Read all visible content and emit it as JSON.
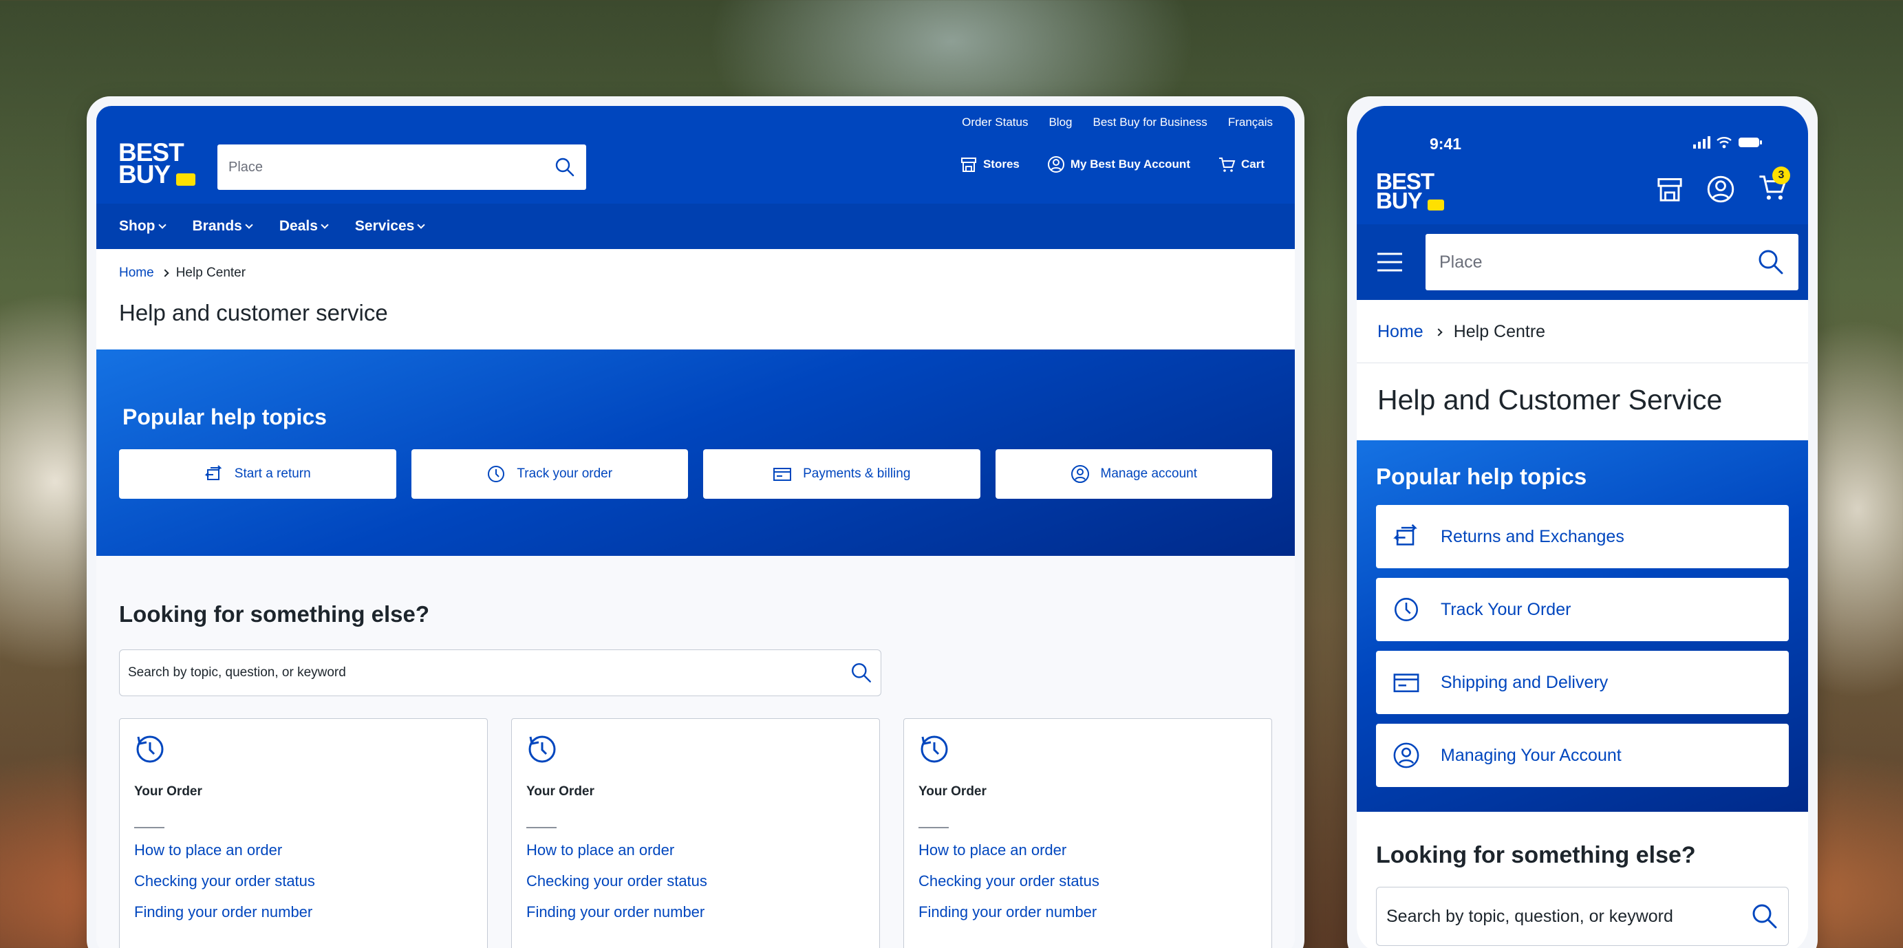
{
  "desktop": {
    "util_links": [
      "Order Status",
      "Blog",
      "Best Buy for Business",
      "Français"
    ],
    "logo": {
      "line1": "BEST",
      "line2": "BUY"
    },
    "search_placeholder": "Place",
    "actions": {
      "stores": "Stores",
      "account": "My Best Buy Account",
      "cart": "Cart"
    },
    "nav": [
      "Shop",
      "Brands",
      "Deals",
      "Services"
    ],
    "breadcrumb": {
      "home": "Home",
      "current": "Help Center"
    },
    "page_title": "Help and customer service",
    "popular": {
      "title": "Popular help topics",
      "topics": [
        {
          "label": "Start a return",
          "icon": "return-icon"
        },
        {
          "label": "Track your order",
          "icon": "clock-icon"
        },
        {
          "label": "Payments & billing",
          "icon": "card-icon"
        },
        {
          "label": "Manage account",
          "icon": "user-icon"
        }
      ]
    },
    "looking": {
      "title": "Looking for something else?",
      "search_placeholder": "Search by topic, question, or keyword"
    },
    "cards": [
      {
        "title": "Your Order",
        "links": [
          "How to place an order",
          "Checking your order status",
          "Finding your order number"
        ]
      },
      {
        "title": "Your Order",
        "links": [
          "How to place an order",
          "Checking your order status",
          "Finding your order number"
        ]
      },
      {
        "title": "Your Order",
        "links": [
          "How to place an order",
          "Checking your order status",
          "Finding your order number"
        ]
      }
    ]
  },
  "mobile": {
    "time": "9:41",
    "cart_count": "3",
    "logo": {
      "line1": "BEST",
      "line2": "BUY"
    },
    "search_placeholder": "Place",
    "breadcrumb": {
      "home": "Home",
      "current": "Help Centre"
    },
    "page_title": "Help and Customer Service",
    "popular": {
      "title": "Popular help topics",
      "topics": [
        {
          "label": "Returns and Exchanges",
          "icon": "return-icon"
        },
        {
          "label": "Track Your Order",
          "icon": "clock-icon"
        },
        {
          "label": "Shipping and Delivery",
          "icon": "card-icon"
        },
        {
          "label": "Managing Your Account",
          "icon": "user-icon"
        }
      ]
    },
    "looking": {
      "title": "Looking for something else?",
      "search_placeholder": "Search by topic, question, or keyword"
    }
  },
  "colors": {
    "brand_blue": "#0046be",
    "nav_blue": "#0040b0",
    "logo_yellow": "#ffe000",
    "text": "#1d252c"
  }
}
